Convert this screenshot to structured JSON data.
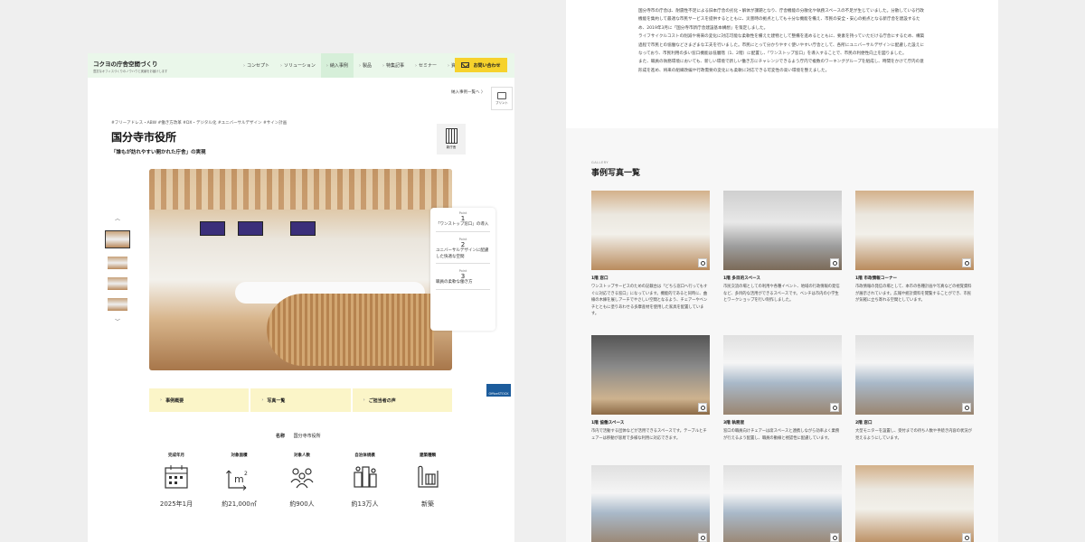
{
  "header": {
    "brand_title": "コクヨの庁舎空間づくり",
    "brand_sub": "豊富なオフィスづくりのノウハウと実績をお届けします",
    "nav": [
      "コンセプト",
      "ソリューション",
      "納入事例",
      "製品",
      "特集記事",
      "セミナー",
      "資料"
    ],
    "active_nav_index": 2,
    "contact_label": "お問い合わせ"
  },
  "page": {
    "back_link": "納入事例一覧へ 〉",
    "print_label": "プリント",
    "tags": "#フリーアドレス・ABW  #働き方改革  #DX・デジタル化  #ユニバーサルデザイン  #サイン計画",
    "title": "国分寺市役所",
    "subtitle": "「誰もが訪れやすい開かれた庁舎」の実現",
    "category_label": "新庁舎",
    "thumb_up": "︿",
    "thumb_down": "﹀",
    "points": [
      {
        "label": "Point",
        "num": "1",
        "text": "「ワンストップ窓口」の導入"
      },
      {
        "label": "Point",
        "num": "2",
        "text": "ユニバーサルデザインに配慮した快適な空間"
      },
      {
        "label": "Point",
        "num": "3",
        "text": "職員の柔軟な働き方"
      }
    ],
    "blue_badge": "OfficeSTOCK",
    "tabs": [
      "事例概要",
      "写真一覧",
      "ご担当者の声"
    ],
    "name_key": "名称",
    "name_val": "国分寺市役所",
    "stats": [
      {
        "label": "完成年月",
        "value": "2025年1月",
        "icon": "calendar-icon"
      },
      {
        "label": "対象面積",
        "value": "約21,000㎡",
        "icon": "area-m2-icon"
      },
      {
        "label": "対象人数",
        "value": "約900人",
        "icon": "people-icon"
      },
      {
        "label": "自治体規模",
        "value": "約13万人",
        "icon": "city-icon"
      },
      {
        "label": "建築種類",
        "value": "新築",
        "icon": "blueprint-icon"
      }
    ]
  },
  "right": {
    "desc": [
      "国分寺市の庁舎は、耐震性不足による旧本庁舎の劣化・解体が課題となり、庁舎機能の分散化や執務スペースの不足が生じていました。分散している行政機能を集約して最適な市民サービスを提供するとともに、災害時の拠点としても十分な機能を備え、市民の安全・安心の拠点となる新庁舎を建設するため、2019年3月に「国分寺市新庁舎建設基本構想」を策定しました。",
      "ライフサイクルコストの削減や将来の変化に対応可能な柔軟性を備えた建物として整備を進めるとともに、要素を持っていただける庁舎にするため、構築過程で市民との協働などさまざまな工夫を行いました。市民にとって分かりやすく使いやすい庁舎として、各所にユニバーサルデザインに配慮した設えになっており、市民利用の多い窓口機能は低層階（1、2階）に配置し、「ワンストップ窓口」を導入することで、市民の利便性向上を図りました。",
      "また、職員の執務環境においても、新しい環境で新しい働き方にチャレンジできるよう庁内で複数のワーキンググループを組成し、時間をかけて庁内の意形成を進め、将来の組織改編や行政需要の変化にも柔軟に対応できる可変性の高い環境を整えました。"
    ],
    "gallery_label": "GALLERY",
    "gallery_title": "事例写真一覧",
    "cards": [
      {
        "cap": "1階 窓口",
        "txt": "ワンストップサービスのための記載台は「どちら窓口へ行ってもすぐに対応できる窓口」になっています。機能的であると同時に、曲線の木練を展しアーチでやさしい空間となるよう、チェアーやベンチとともに塗りあわせる多摩産材を使用した家具を配置しています。"
      },
      {
        "cap": "1階 多目的スペース",
        "txt": "市民交流の場としての利用や各種イベント、地域の行政情報の発信など、多目的な活用ができるスペースです。ベンチは市内の小学生とワークショップを行い制作しました。"
      },
      {
        "cap": "1階 市政情報コーナー",
        "txt": "市政情報の発信の場として、本市の各種計画や写真などの視覚資料が展示されています。広報や統計資料を閲覧することができ、市民が気軽に立ち寄れる空間としています。"
      },
      {
        "cap": "1階 協働スペース",
        "txt": "市内で活動する団体などが活用できるスペースです。テーブルとチェアーは移動が容易で多様な利用に対応できます。"
      },
      {
        "cap": "3階 執務室",
        "txt": "窓口の職員向けチェアーは席スペースと連携しながら効率よく業務が行えるよう配置し、職員の動線と視認性に配慮しています。"
      },
      {
        "cap": "2階 窓口",
        "txt": "大型モニターを設置し、受付までの待ち人数や手続き内容の状況が見えるようにしています。"
      },
      {
        "cap": "",
        "txt": ""
      },
      {
        "cap": "",
        "txt": ""
      },
      {
        "cap": "",
        "txt": ""
      }
    ]
  }
}
